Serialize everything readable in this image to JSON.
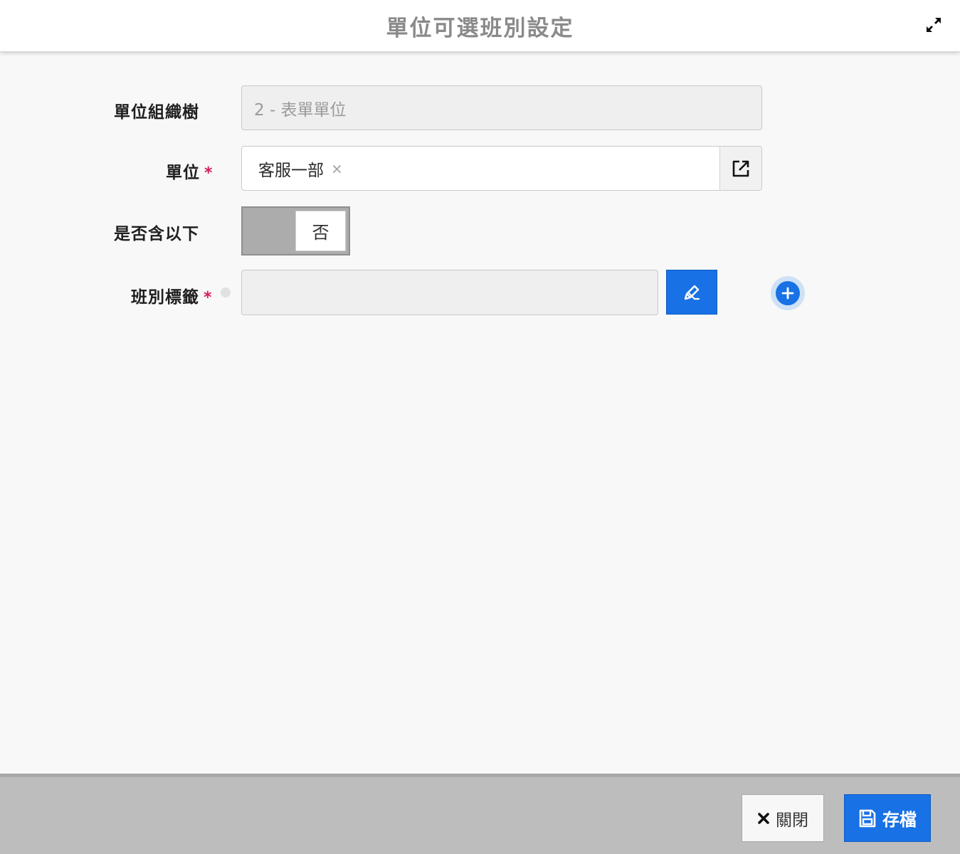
{
  "header": {
    "title": "單位可選班別設定",
    "expand_icon": "expand-arrows-icon"
  },
  "form": {
    "org_tree": {
      "label": "單位組織樹",
      "value": "2 - 表單單位"
    },
    "unit": {
      "label": "單位",
      "required_mark": "*",
      "chip": "客服一部",
      "chip_remove": "×",
      "open_icon": "external-link-icon"
    },
    "include_sub": {
      "label": "是否含以下",
      "toggle_value": "否"
    },
    "shift_tag": {
      "label": "班別標籤",
      "required_mark": "*",
      "value": "",
      "edit_icon": "pencil-icon",
      "add_icon": "plus-circle-icon"
    }
  },
  "footer": {
    "close_label": "關閉",
    "close_icon": "close-x-icon",
    "save_label": "存檔",
    "save_icon": "floppy-disk-icon"
  },
  "colors": {
    "primary": "#1871e5",
    "required": "#d81b60",
    "title_gray": "#8a8a8a",
    "footer_bg": "#bdbdbd"
  }
}
